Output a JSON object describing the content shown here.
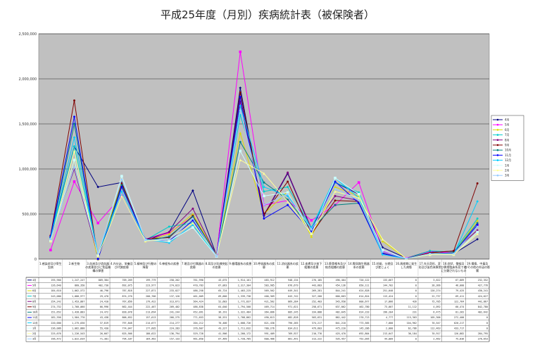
{
  "title": "平成25年度（月別）疾病統計表（被保険者）",
  "chart_data": {
    "type": "line",
    "title": "平成25年度（月別）疾病統計表（被保険者）",
    "ylim": [
      0,
      2500000
    ],
    "yticks": [
      "0",
      "500,000",
      "1,000,000",
      "1,500,000",
      "2,000,000",
      "2,500,000"
    ],
    "grid": true,
    "legend": "right",
    "plot_bg": "#c0c0c0",
    "categories": [
      "1.感染症及び寄生虫病",
      "2.新生物",
      "3.血液及び造血器の疾患並びに免疫機構の障害",
      "4.内分泌、栄養及び代謝疾患",
      "5.精神及び行動の障害",
      "6.神経系の疾患",
      "7.眼及び付属器の疾患",
      "8.耳及び乳様突起の疾患",
      "9.循環器系の疾患",
      "10.呼吸器系の疾患",
      "11.消化器系の疾患",
      "12.皮膚及び皮下組織の疾患",
      "13.筋骨格系及び結合組織の疾患",
      "14.腎尿路生殖器系の疾患",
      "15.妊娠、分娩及び産じょく",
      "16.周産期に発生した病態",
      "17.先天奇形、変形及び染色体異常",
      "18.症状、徴候及び異常臨床所見で他に分類されないもの",
      "19.損傷、中毒及びその他の外因の影響"
    ],
    "series": [
      {
        "name": "4月",
        "color": "#000080",
        "values": [
          240000,
          1250000,
          800000,
          850000,
          200000,
          300000,
          760000,
          40000,
          1900000,
          480000,
          950000,
          330000,
          850000,
          720000,
          130000,
          10000,
          90000,
          60000,
          220000
        ]
      },
      {
        "name": "5月",
        "color": "#ff00ff",
        "values": [
          100000,
          860000,
          400000,
          700000,
          220000,
          290000,
          470000,
          50000,
          2300000,
          600000,
          650000,
          430000,
          600000,
          850000,
          90000,
          10000,
          80000,
          70000,
          380000
        ]
      },
      {
        "name": "6月",
        "color": "#dddd00",
        "values": [
          200000,
          1100000,
          0,
          880000,
          200000,
          280000,
          500000,
          50000,
          1400000,
          500000,
          750000,
          250000,
          800000,
          700000,
          200000,
          5000,
          70000,
          60000,
          430000
        ]
      },
      {
        "name": "7月",
        "color": "#00cccc",
        "values": [
          220000,
          1250000,
          50000,
          700000,
          210000,
          360000,
          400000,
          40000,
          1600000,
          750000,
          800000,
          350000,
          850000,
          740000,
          80000,
          5000,
          90000,
          80000,
          450000
        ]
      },
      {
        "name": "8月",
        "color": "#800080",
        "values": [
          250000,
          1000000,
          40000,
          800000,
          220000,
          300000,
          560000,
          40000,
          1750000,
          490000,
          960000,
          340000,
          700000,
          650000,
          70000,
          5000,
          70000,
          90000,
          320000
        ]
      },
      {
        "name": "9月",
        "color": "#800000",
        "values": [
          260000,
          1760000,
          0,
          840000,
          220000,
          240000,
          480000,
          40000,
          1850000,
          500000,
          860000,
          280000,
          650000,
          640000,
          80000,
          5000,
          70000,
          90000,
          840000
        ]
      },
      {
        "name": "10月",
        "color": "#008080",
        "values": [
          240000,
          1500000,
          20000,
          820000,
          200000,
          250000,
          470000,
          40000,
          1300000,
          850000,
          660000,
          330000,
          600000,
          620000,
          80000,
          5000,
          60000,
          70000,
          400000
        ]
      },
      {
        "name": "11月",
        "color": "#0000ff",
        "values": [
          250000,
          1580000,
          0,
          800000,
          220000,
          200000,
          430000,
          40000,
          1800000,
          450000,
          600000,
          300000,
          860000,
          620000,
          60000,
          5000,
          60000,
          60000,
          380000
        ]
      },
      {
        "name": "12月",
        "color": "#00ccff",
        "values": [
          230000,
          1350000,
          60000,
          750000,
          220000,
          180000,
          380000,
          30000,
          1700000,
          800000,
          700000,
          350000,
          900000,
          680000,
          50000,
          5000,
          50000,
          50000,
          640000
        ]
      },
      {
        "name": "1月",
        "color": "#ccffff",
        "values": [
          200000,
          1100000,
          40000,
          920000,
          210000,
          200000,
          350000,
          30000,
          1200000,
          700000,
          740000,
          280000,
          900000,
          720000,
          100000,
          5000,
          50000,
          50000,
          300000
        ]
      },
      {
        "name": "2月",
        "color": "#ffff99",
        "values": [
          200000,
          1200000,
          30000,
          700000,
          200000,
          220000,
          400000,
          40000,
          1100000,
          950000,
          640000,
          280000,
          750000,
          680000,
          220000,
          5000,
          50000,
          50000,
          280000
        ]
      },
      {
        "name": "3月",
        "color": "#99ccff",
        "values": [
          220000,
          1020000,
          60000,
          880000,
          210000,
          220000,
          450000,
          30000,
          1650000,
          600000,
          720000,
          330000,
          780000,
          650000,
          80000,
          5000,
          60000,
          60000,
          360000
        ]
      }
    ],
    "table": {
      "rows": [
        {
          "label": "4月",
          "cells": [
            "195,960",
            "1,247,247",
            "809,384",
            "709,269",
            "199,779",
            "258,262",
            "761,990",
            "43,075",
            "1,914,161",
            "483,912",
            "948,134",
            "276,185",
            "496,404",
            "720,122",
            "133,667",
            "0",
            "3,622",
            "67,889",
            "232,352"
          ]
        },
        {
          "label": "5月",
          "cells": [
            "126,640",
            "860,350",
            "402,730",
            "692,075",
            "223,977",
            "274,023",
            "470,783",
            "67,063",
            "2,317,304",
            "583,985",
            "676,679",
            "443,683",
            "454,136",
            "850,111",
            "144,702",
            "0",
            "28,366",
            "46,000",
            "427,776"
          ]
        },
        {
          "label": "6月",
          "cells": [
            "184,610",
            "1,062,572",
            "46,796",
            "787,818",
            "227,871",
            "233,027",
            "486,258",
            "65,724",
            "1,403,225",
            "569,562",
            "649,341",
            "269,281",
            "844,241",
            "624,828",
            "251,040",
            "0",
            "120,274",
            "79,425",
            "430,241"
          ]
        },
        {
          "label": "7月",
          "cells": [
            "243,080",
            "1,080,977",
            "29,470",
            "874,270",
            "200,766",
            "137,120",
            "461,009",
            "69,660",
            "1,339,738",
            "400,369",
            "643,742",
            "327,260",
            "600,663",
            "614,824",
            "113,424",
            "0",
            "22,737",
            "69,411",
            "424,627"
          ]
        },
        {
          "label": "8月",
          "cells": [
            "254,242",
            "1,453,887",
            "24,410",
            "767,856",
            "179,422",
            "313,671",
            "564,424",
            "52,683",
            "1,772,837",
            "421,562",
            "869,284",
            "252,403",
            "545,958",
            "800,677",
            "17,866",
            "426",
            "75,785",
            "122,764",
            "442,867"
          ]
        },
        {
          "label": "9月",
          "cells": [
            "274,752",
            "1,760,060",
            "66,996",
            "662,444",
            "222,467",
            "209,402",
            "486,838",
            "64,040",
            "1,794,500",
            "469,714",
            "971,621",
            "258,671",
            "637,062",
            "462,780",
            "73,007",
            "11,112",
            "4,092",
            "60,474",
            "842,780"
          ]
        },
        {
          "label": "10月",
          "cells": [
            "151,652",
            "1,428,883",
            "24,472",
            "828,078",
            "213,694",
            "241,244",
            "452,091",
            "36,191",
            "1,322,484",
            "364,066",
            "805,245",
            "334,888",
            "482,045",
            "624,233",
            "196,204",
            "231",
            "6,475",
            "81,262",
            "402,642"
          ]
        },
        {
          "label": "11月",
          "cells": [
            "182,356",
            "1,584,770",
            "43,438",
            "806,652",
            "157,613",
            "266,275",
            "771,653",
            "58,531",
            "1,708,862",
            "490,613",
            "682,828",
            "503,631",
            "862,442",
            "270,713",
            "4,777",
            "115,303",
            "105,306",
            "272,400",
            "0"
          ]
        },
        {
          "label": "12月",
          "cells": [
            "220,000",
            "1,275,030",
            "37,819",
            "797,848",
            "214,677",
            "214,277",
            "204,212",
            "70,400",
            "1,608,726",
            "821,430",
            "790,285",
            "374,217",
            "841,218",
            "773,585",
            "7,000",
            "104,962",
            "70,547",
            "620,217",
            "0"
          ]
        },
        {
          "label": "1月",
          "cells": [
            "236,086",
            "1,062,888",
            "55,430",
            "774,047",
            "177,605",
            "224,283",
            "376,607",
            "43,227",
            "1,711,632",
            "780,276",
            "834,611",
            "479,603",
            "475,220",
            "145,286",
            "2,000",
            "62,786",
            "112,463",
            "433,717",
            "0"
          ]
        },
        {
          "label": "2月",
          "cells": [
            "225,676",
            "1,226,543",
            "26,667",
            "625,566",
            "180,622",
            "136,794",
            "529,728",
            "41,906",
            "1,200,172",
            "991,409",
            "769,927",
            "210,776",
            "425,470",
            "692,804",
            "213,047",
            "36,184",
            "70,917",
            "126,882",
            "284,795"
          ]
        },
        {
          "label": "3月",
          "cells": [
            "196,472",
            "1,022,634",
            "71,381",
            "794,187",
            "164,462",
            "157,133",
            "461,850",
            "67,469",
            "1,728,785",
            "600,466",
            "661,441",
            "313,222",
            "535,457",
            "752,095",
            "44,009",
            "0",
            "2,462",
            "75,836",
            "276,653"
          ]
        }
      ]
    }
  }
}
